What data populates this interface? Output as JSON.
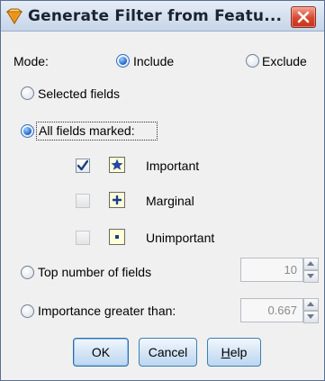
{
  "dialog": {
    "title": "Generate Filter from Featu...",
    "close_label": "close"
  },
  "mode": {
    "label": "Mode:",
    "include_label": "Include",
    "exclude_label": "Exclude",
    "selected": "Include"
  },
  "selection": {
    "selected_fields_label": "Selected fields",
    "all_marked_label": "All fields marked:",
    "selected": "All fields marked:"
  },
  "marks": [
    {
      "label": "Important",
      "checked": true,
      "icon": "star-icon"
    },
    {
      "label": "Marginal",
      "checked": false,
      "icon": "plus-icon"
    },
    {
      "label": "Unimportant",
      "checked": false,
      "icon": "dot-icon"
    }
  ],
  "top_number": {
    "label": "Top number of fields",
    "value": "10"
  },
  "importance": {
    "label": "Importance greater than:",
    "value": "0.667"
  },
  "buttons": {
    "ok": "OK",
    "cancel": "Cancel",
    "help_prefix": "",
    "help_underlined": "H",
    "help_rest": "elp"
  },
  "colors": {
    "accent": "#2c6ec2",
    "close_button": "#d8462e",
    "star": "#2546a8"
  }
}
